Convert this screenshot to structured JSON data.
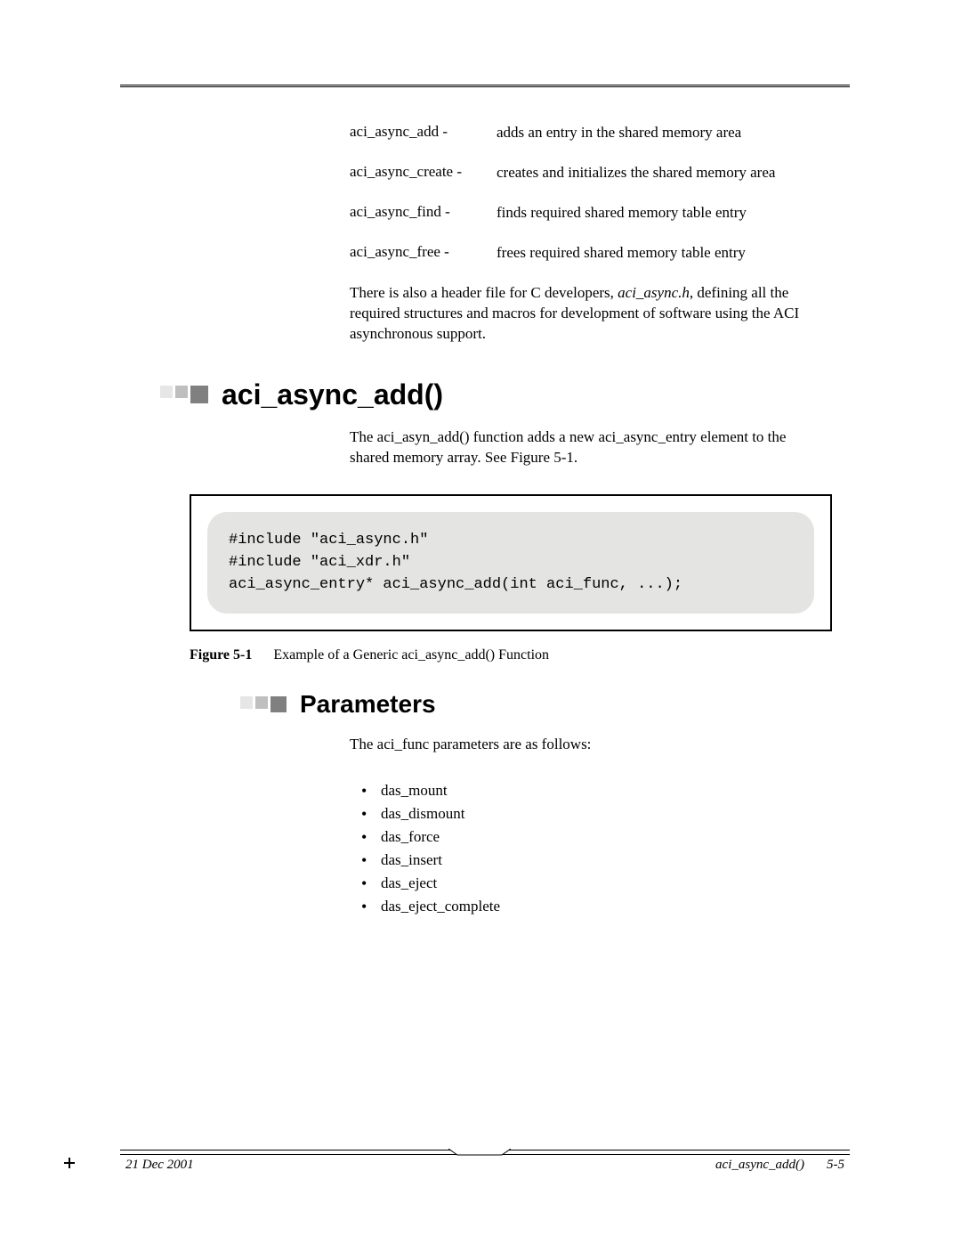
{
  "definitions": [
    {
      "term": "aci_async_add -",
      "desc": "adds an entry in the shared memory area"
    },
    {
      "term": "aci_async_create -",
      "desc": "creates and initializes the shared memory area"
    },
    {
      "term": "aci_async_find  -",
      "desc": "finds required shared memory table entry"
    },
    {
      "term": "aci_async_free -",
      "desc": "frees required shared memory table entry"
    }
  ],
  "intro_para_pre": "There is also a header file for C developers, ",
  "intro_para_italic": "aci_async.h",
  "intro_para_post": ", defining all the required structures and macros for development of software using the ACI asynchronous support.",
  "heading1": "aci_async_add()",
  "body1": "The aci_asyn_add() function adds a new aci_async_entry element to the shared memory array. See Figure 5-1.",
  "code_block": "#include \"aci_async.h\"\n#include \"aci_xdr.h\"\naci_async_entry* aci_async_add(int aci_func, ...);",
  "figure_label": "Figure 5-1",
  "figure_caption": "Example of a Generic aci_async_add() Function",
  "heading2": "Parameters",
  "params_intro": "The aci_func parameters are as follows:",
  "params": [
    "das_mount",
    "das_dismount",
    "das_force",
    "das_insert",
    "das_eject",
    "das_eject_complete"
  ],
  "footer_date": "21 Dec 2001",
  "footer_section": "aci_async_add()",
  "footer_page": "5-5"
}
